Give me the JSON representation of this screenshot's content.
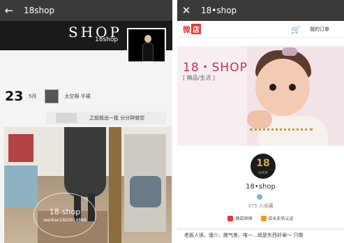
{
  "left": {
    "header": {
      "back_icon": "←",
      "title": "18shop"
    },
    "banner": {
      "wordmark": "SHOP",
      "subtitle": "18shop"
    },
    "post": {
      "day": "23",
      "month": "5月",
      "title": "太空棉 半裙"
    },
    "post2": {
      "text": "之前就出一批 分分钟就空"
    },
    "watermark": {
      "title": "18-shop",
      "id": "weidian1820914888"
    }
  },
  "right": {
    "header": {
      "close_icon": "✕",
      "title": "18•shop"
    },
    "shopbar": {
      "logo_part1": "微",
      "logo_part2": "店",
      "cart_icon": "🛒",
      "orders_label": "我的订单"
    },
    "hero": {
      "brand": "18・SHOP",
      "tagline": "[ 精品/生活 ]"
    },
    "shop": {
      "avatar_number": "18",
      "avatar_small": "SHOP",
      "name": "18•shop",
      "followers": "375 人收藏",
      "badges": [
        {
          "label": "微店担保",
          "color": "#e53935"
        },
        {
          "label": "店长实名认证",
          "color": "#f39c12"
        }
      ],
      "description": "老板人很、骚少、脾气差、唯一…就是东西好😁～ 只做"
    }
  }
}
